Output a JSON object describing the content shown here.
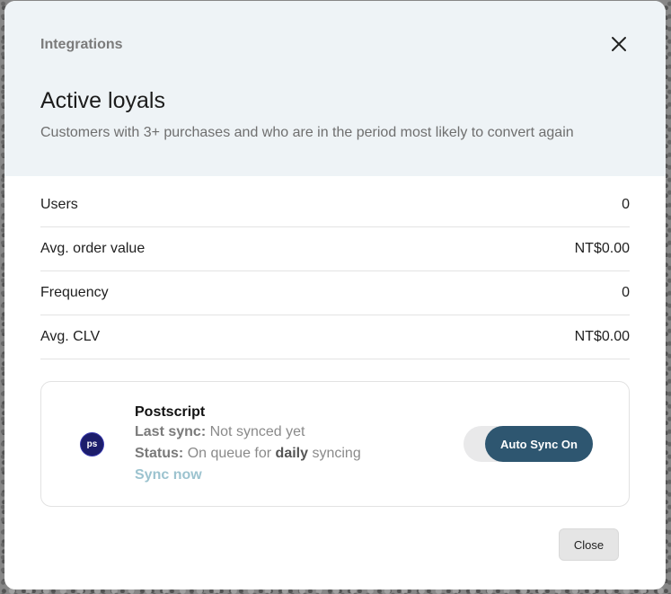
{
  "header": {
    "eyebrow": "Integrations",
    "title": "Active loyals",
    "subtitle": "Customers with 3+ purchases and who are in the period most likely to convert again"
  },
  "stats": [
    {
      "label": "Users",
      "value": "0"
    },
    {
      "label": "Avg. order value",
      "value": "NT$0.00"
    },
    {
      "label": "Frequency",
      "value": "0"
    },
    {
      "label": "Avg. CLV",
      "value": "NT$0.00"
    }
  ],
  "integration": {
    "logo_text": "ps",
    "name": "Postscript",
    "last_sync_label": "Last sync:",
    "last_sync_value": "Not synced yet",
    "status_label": "Status:",
    "status_prefix": "On queue for",
    "status_frequency": "daily",
    "status_suffix": "syncing",
    "sync_now": "Sync now",
    "toggle_label": "Auto Sync On"
  },
  "footer": {
    "close_label": "Close"
  },
  "colors": {
    "header_bg": "#eef3f6",
    "toggle_active": "#2e5670",
    "link": "#9cc3cf",
    "logo_bg": "#1c1d6b"
  },
  "icons": {
    "close": "close-icon",
    "logo": "postscript-logo"
  }
}
